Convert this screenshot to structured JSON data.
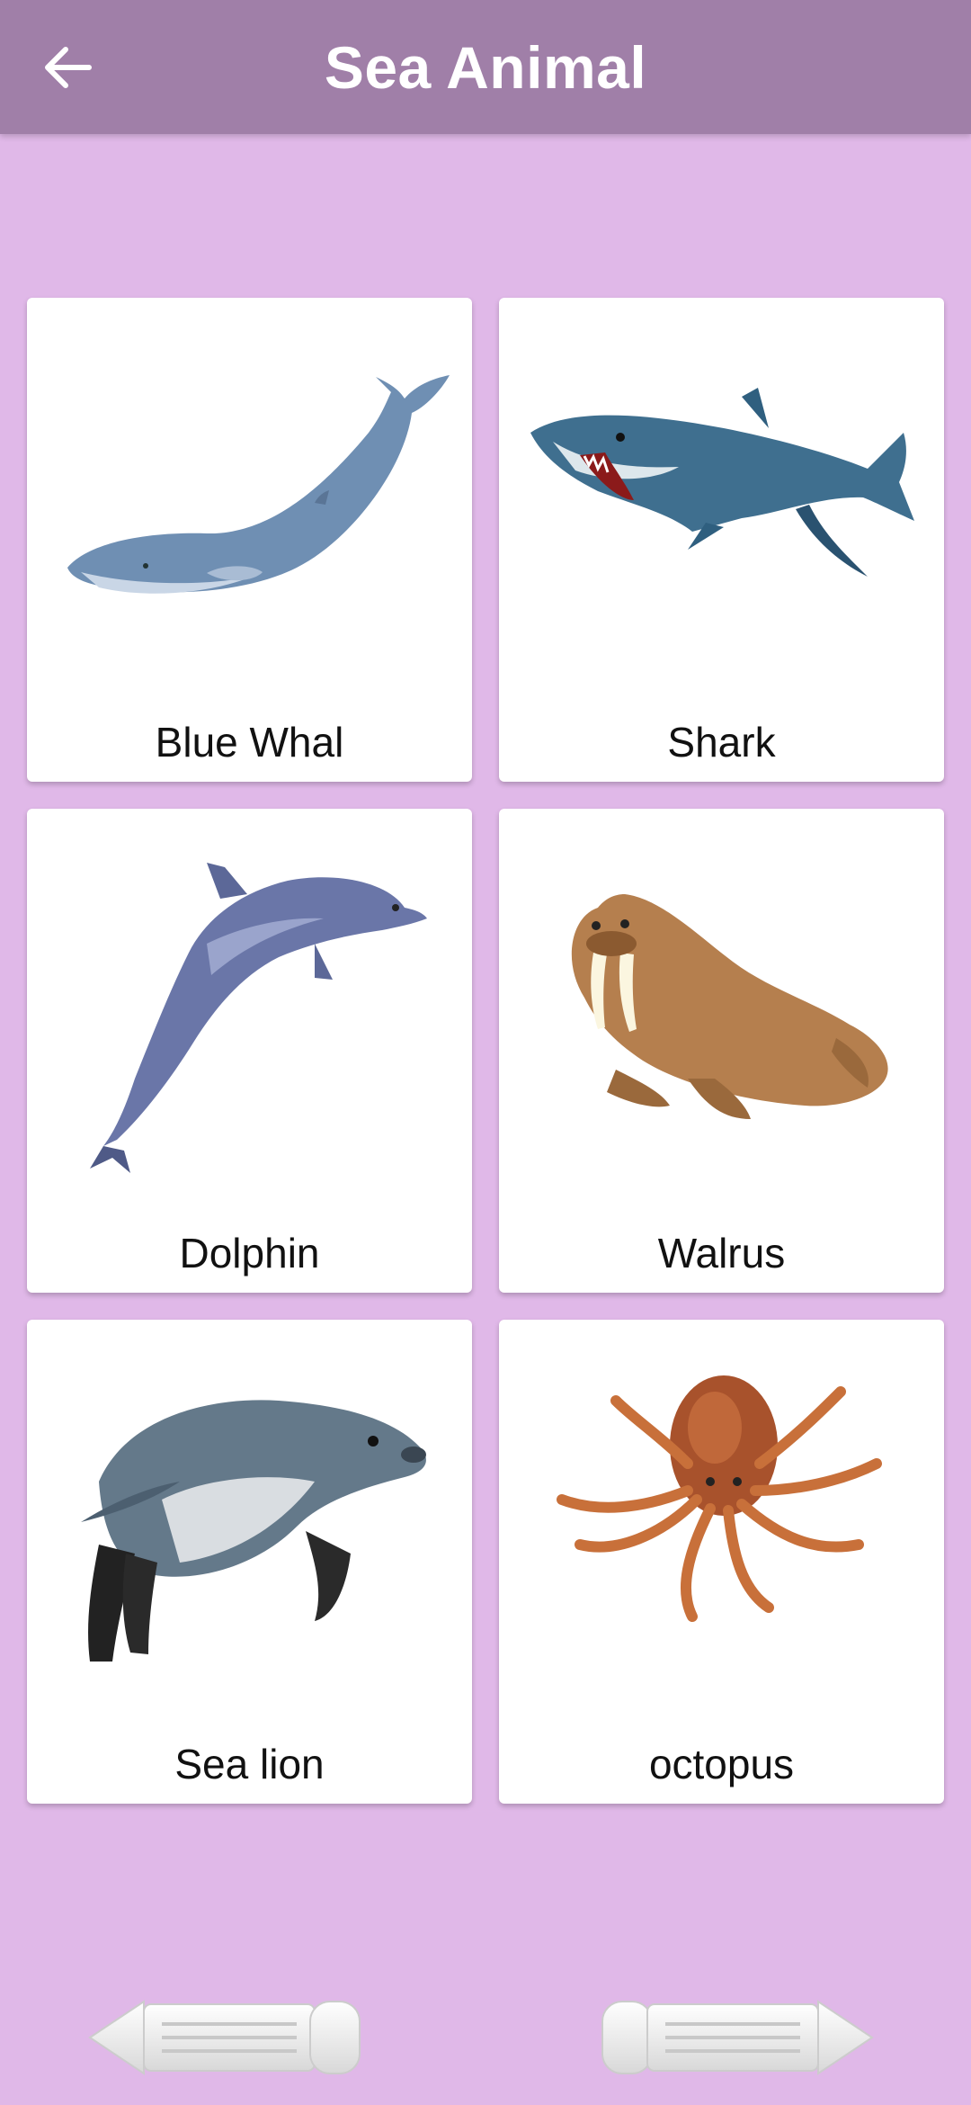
{
  "header": {
    "title": "Sea Animal",
    "back_icon": "arrow-left-icon"
  },
  "colors": {
    "appbar": "#a07fa8",
    "background": "#e0b8e8",
    "card": "#ffffff"
  },
  "animals": [
    {
      "label": "Blue Whal",
      "image": "blue-whale-image"
    },
    {
      "label": "Shark",
      "image": "shark-image"
    },
    {
      "label": "Dolphin",
      "image": "dolphin-image"
    },
    {
      "label": "Walrus",
      "image": "walrus-image"
    },
    {
      "label": "Sea lion",
      "image": "sea-lion-image"
    },
    {
      "label": "octopus",
      "image": "octopus-image"
    }
  ],
  "footer": {
    "prev_icon": "pencil-arrow-left-icon",
    "next_icon": "pencil-arrow-right-icon"
  }
}
